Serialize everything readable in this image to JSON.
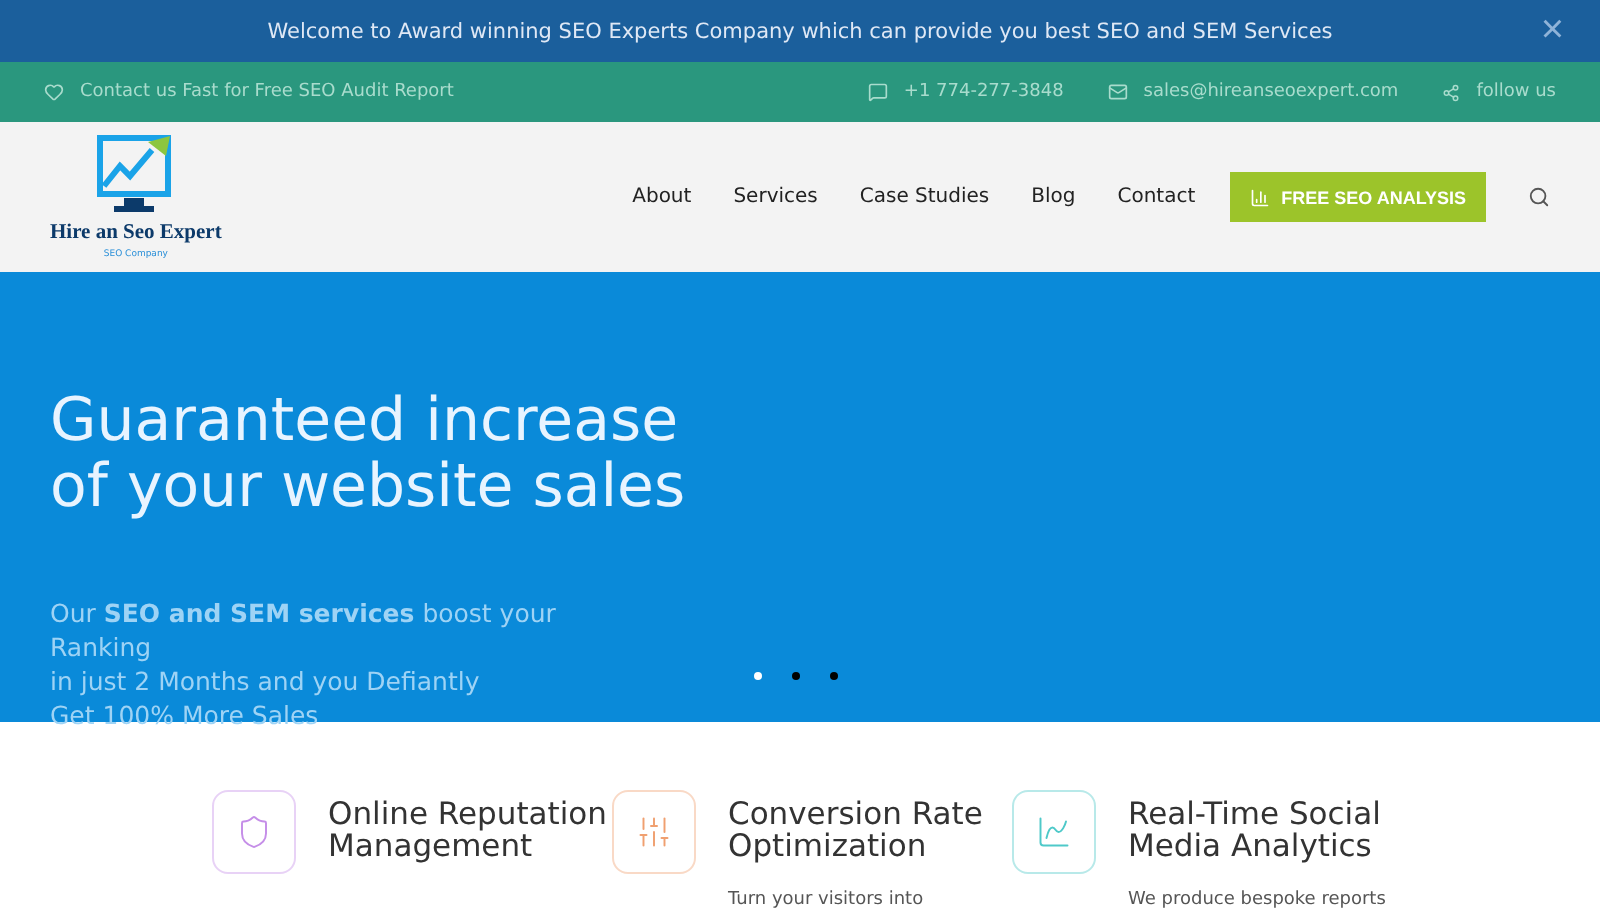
{
  "announcement": {
    "text": "Welcome to Award winning SEO Experts Company which can provide you best SEO and SEM Services",
    "close": "×"
  },
  "topbar": {
    "left": "Contact us Fast for Free SEO Audit Report",
    "phone": "+1 774-277-3848",
    "email": "sales@hireanseoexpert.com",
    "follow": "follow us"
  },
  "logo": {
    "name": "Hire an Seo Expert",
    "tagline": "SEO Company"
  },
  "nav": [
    {
      "label": "About"
    },
    {
      "label": "Services"
    },
    {
      "label": "Case Studies"
    },
    {
      "label": "Blog"
    },
    {
      "label": "Contact"
    }
  ],
  "cta": "FREE SEO ANALYSIS",
  "hero": {
    "title": "Guaranteed increase of your website sales",
    "lines": [
      "Our **SEO and SEM services** boost your Ranking",
      "in just 2 Months and you Defiantly",
      "Get 100% More Sales"
    ],
    "slides": [
      {
        "selected": true
      },
      {
        "selected": false
      },
      {
        "selected": false
      }
    ]
  },
  "features": [
    {
      "kind": "shield",
      "title": "Online Reputation Management",
      "color": "#c58ee8"
    },
    {
      "kind": "sliders",
      "title": "Conversion Rate Optimization",
      "text": "Turn your visitors into",
      "color": "#f0a070"
    },
    {
      "kind": "chart",
      "title": "Real-Time Social Media Analytics",
      "text": "We produce bespoke reports",
      "color": "#4ec9c9"
    }
  ]
}
